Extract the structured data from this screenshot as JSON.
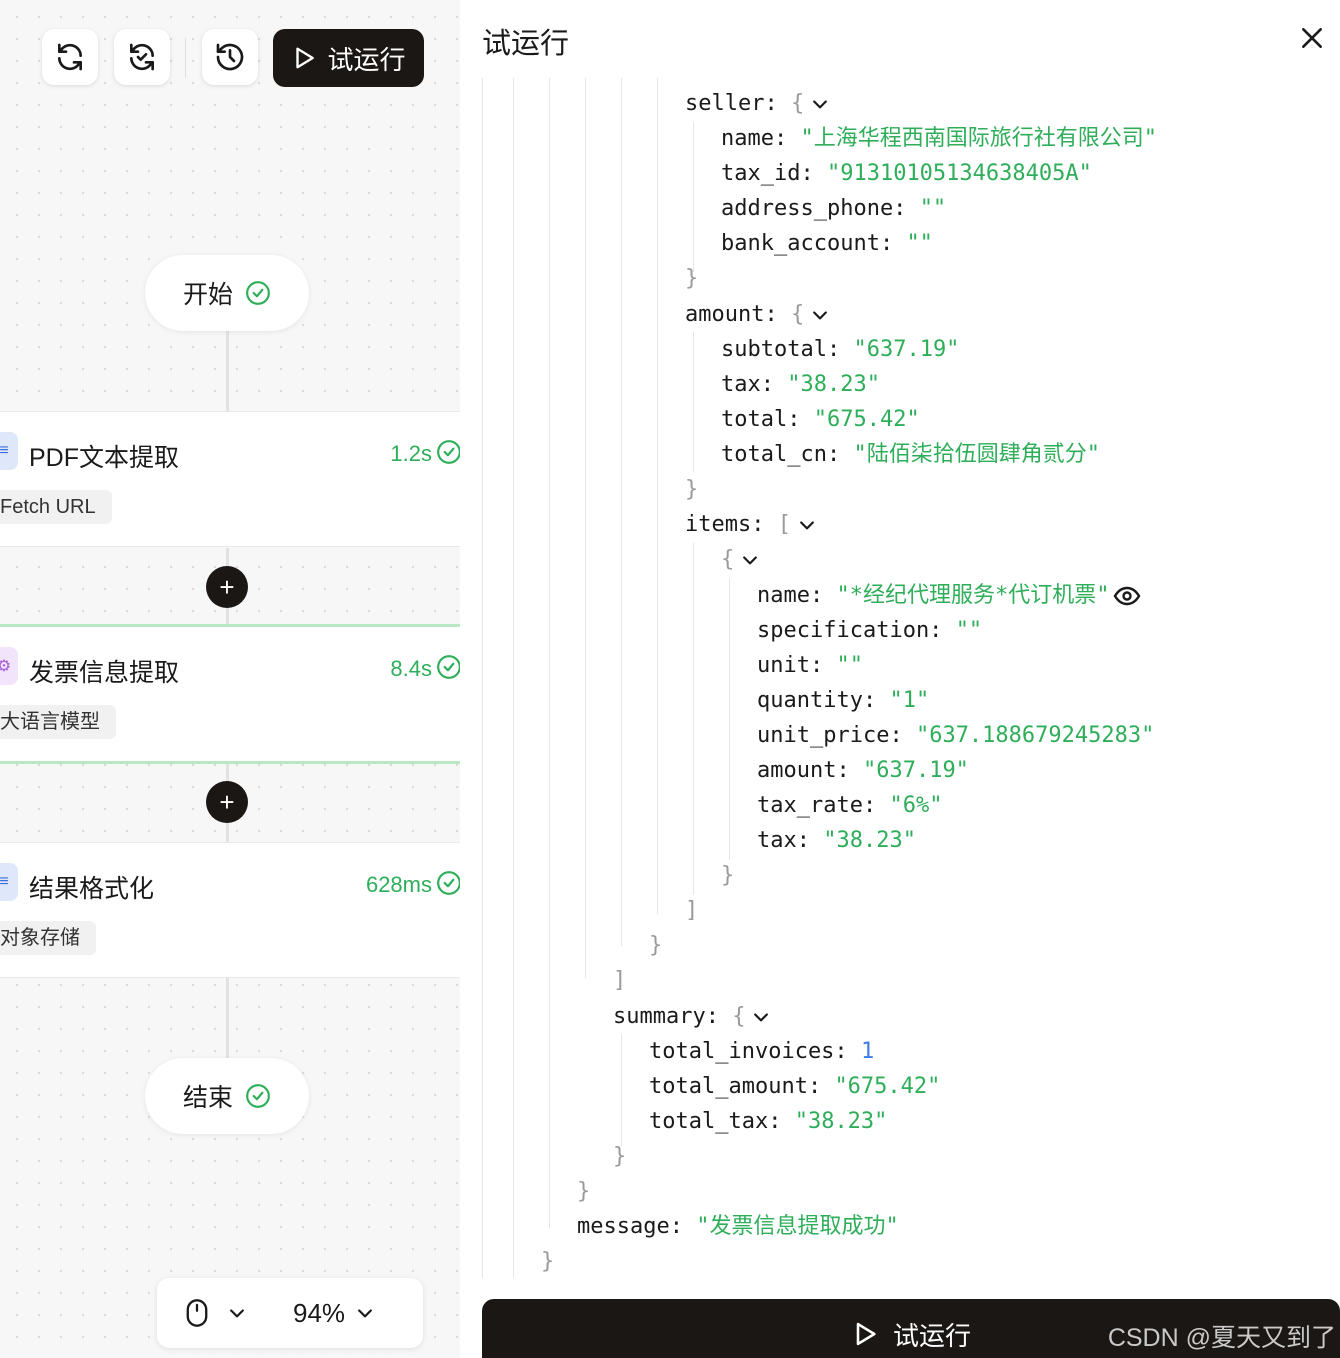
{
  "toolbar": {
    "run_label": "试运行"
  },
  "nodes": {
    "start": {
      "label": "开始"
    },
    "end": {
      "label": "结束"
    },
    "pdf": {
      "title": "PDF文本提取",
      "time": "1.2s",
      "tag": "Fetch URL",
      "icon": "text-lines-icon"
    },
    "invoice": {
      "title": "发票信息提取",
      "time": "8.4s",
      "tag": "大语言模型",
      "icon": "llm-icon"
    },
    "format": {
      "title": "结果格式化",
      "time": "628ms",
      "tag": "对象存储",
      "icon": "text-lines-icon"
    }
  },
  "zoom": {
    "level": "94%"
  },
  "panel": {
    "title": "试运行",
    "run_label": "试运行",
    "watermark": "CSDN @夏天又到了"
  },
  "json": {
    "seller": {
      "key": "seller:",
      "name_key": "name:",
      "name": "\"上海华程西南国际旅行社有限公司\"",
      "tax_id_key": "tax_id:",
      "tax_id": "\"91310105134638405A\"",
      "address_phone_key": "address_phone:",
      "address_phone": "\"\"",
      "bank_account_key": "bank_account:",
      "bank_account": "\"\""
    },
    "amount": {
      "key": "amount:",
      "subtotal_key": "subtotal:",
      "subtotal": "\"637.19\"",
      "tax_key": "tax:",
      "tax": "\"38.23\"",
      "total_key": "total:",
      "total": "\"675.42\"",
      "total_cn_key": "total_cn:",
      "total_cn": "\"陆佰柒拾伍圆肆角贰分\""
    },
    "items": {
      "key": "items:",
      "name_key": "name:",
      "name": "\"*经纪代理服务*代订机票\"",
      "specification_key": "specification:",
      "specification": "\"\"",
      "unit_key": "unit:",
      "unit": "\"\"",
      "quantity_key": "quantity:",
      "quantity": "\"1\"",
      "unit_price_key": "unit_price:",
      "unit_price": "\"637.188679245283\"",
      "amount_key": "amount:",
      "amount": "\"637.19\"",
      "tax_rate_key": "tax_rate:",
      "tax_rate": "\"6%\"",
      "tax_key": "tax:",
      "tax": "\"38.23\""
    },
    "summary": {
      "key": "summary:",
      "total_invoices_key": "total_invoices:",
      "total_invoices": "1",
      "total_amount_key": "total_amount:",
      "total_amount": "\"675.42\"",
      "total_tax_key": "total_tax:",
      "total_tax": "\"38.23\""
    },
    "message_key": "message:",
    "message": "\"发票信息提取成功\"",
    "brackets": {
      "open_obj": "{",
      "close_obj": "}",
      "open_arr": "[",
      "close_arr": "]"
    }
  },
  "colors": {
    "accent_dark": "#1a1715",
    "success_green": "#2fae5a",
    "json_string": "#2fae5a",
    "json_number": "#3b7de0"
  }
}
